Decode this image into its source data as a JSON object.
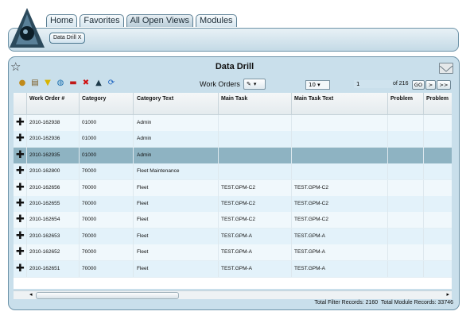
{
  "nav": {
    "tabs": [
      "Home",
      "Favorites",
      "All Open Views",
      "Modules"
    ],
    "open_chip": "Data Drill X"
  },
  "panel": {
    "title": "Data Drill",
    "work_orders_label": "Work Orders",
    "page_size": "10",
    "page_number": "1",
    "page_of": "of 216",
    "go_label": "GO",
    "next_label": ">",
    "last_label": ">>"
  },
  "grid": {
    "columns": [
      "Work Order #",
      "Category",
      "Category Text",
      "Main Task",
      "Main Task Text",
      "Problem",
      "Problem"
    ],
    "rows": [
      [
        "2010-162938",
        "01000",
        "Admin",
        "",
        ""
      ],
      [
        "2010-162936",
        "01000",
        "Admin",
        "",
        ""
      ],
      [
        "2010-162935",
        "01000",
        "Admin",
        "",
        ""
      ],
      [
        "2010-162800",
        "70000",
        "Fleet Maintenance",
        "",
        ""
      ],
      [
        "2010-162656",
        "70000",
        "Fleet",
        "TEST.GPM-C2",
        "TEST.GPM-C2"
      ],
      [
        "2010-162655",
        "70000",
        "Fleet",
        "TEST.GPM-C2",
        "TEST.GPM-C2"
      ],
      [
        "2010-162654",
        "70000",
        "Fleet",
        "TEST.GPM-C2",
        "TEST.GPM-C2"
      ],
      [
        "2010-162653",
        "70000",
        "Fleet",
        "TEST.GPM-A",
        "TEST.GPM-A"
      ],
      [
        "2010-162652",
        "70000",
        "Fleet",
        "TEST.GPM-A",
        "TEST.GPM-A"
      ],
      [
        "2010-162651",
        "70000",
        "Fleet",
        "TEST.GPM-A",
        "TEST.GPM-A"
      ]
    ],
    "selected_row": 2
  },
  "footer": {
    "filter_records": "Total Filter Records: 2160",
    "module_records": "Total Module Records: 33746"
  },
  "colors": {
    "panel_bg": "#c9dfeb",
    "selected_row": "#8eb3c2",
    "border": "#6d93a8"
  },
  "icons": [
    "logo-icon",
    "star-icon",
    "mail-icon",
    "refresh-icon",
    "print-icon",
    "filter-icon",
    "globe-icon",
    "toolbox-icon",
    "delete-icon",
    "navigate-icon",
    "sync-icon"
  ]
}
